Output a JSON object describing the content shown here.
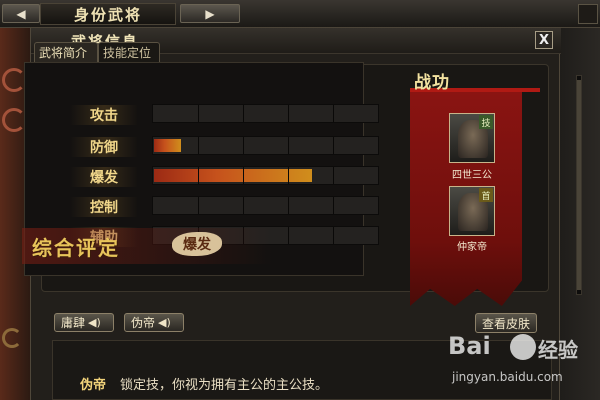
{
  "top": {
    "title": "身份武将",
    "prev_icon": "chevron-left-icon",
    "next_icon": "chevron-right-icon"
  },
  "panel": {
    "title": "武将信息",
    "close_label": "X"
  },
  "tabs": [
    {
      "label": "武将简介"
    },
    {
      "label": "技能定位"
    }
  ],
  "stats": [
    {
      "label": "攻击",
      "level": 0
    },
    {
      "label": "防御",
      "level": 0.12
    },
    {
      "label": "爆发",
      "level": 0.7
    },
    {
      "label": "控制",
      "level": 0
    },
    {
      "label": "辅助",
      "level": 0
    }
  ],
  "rating": {
    "title": "综合评定",
    "value": "爆发"
  },
  "merit": {
    "title": "战功",
    "cards": [
      {
        "name": "四世三公",
        "tag": "技"
      },
      {
        "name": "仲家帝",
        "tag": "首"
      }
    ]
  },
  "skills": [
    {
      "label": "庸肆"
    },
    {
      "label": "伪帝"
    }
  ],
  "skin_button": "查看皮肤",
  "description": {
    "name": "伪帝",
    "text": "锁定技，你视为拥有主公的主公技。"
  },
  "watermark": {
    "logo": "Bai",
    "suffix": "经验",
    "url": "jingyan.baidu.com"
  },
  "colors": {
    "accent_red": "#8a1412",
    "gold": "#f0d68a",
    "bar_fill": "#c6521c"
  }
}
